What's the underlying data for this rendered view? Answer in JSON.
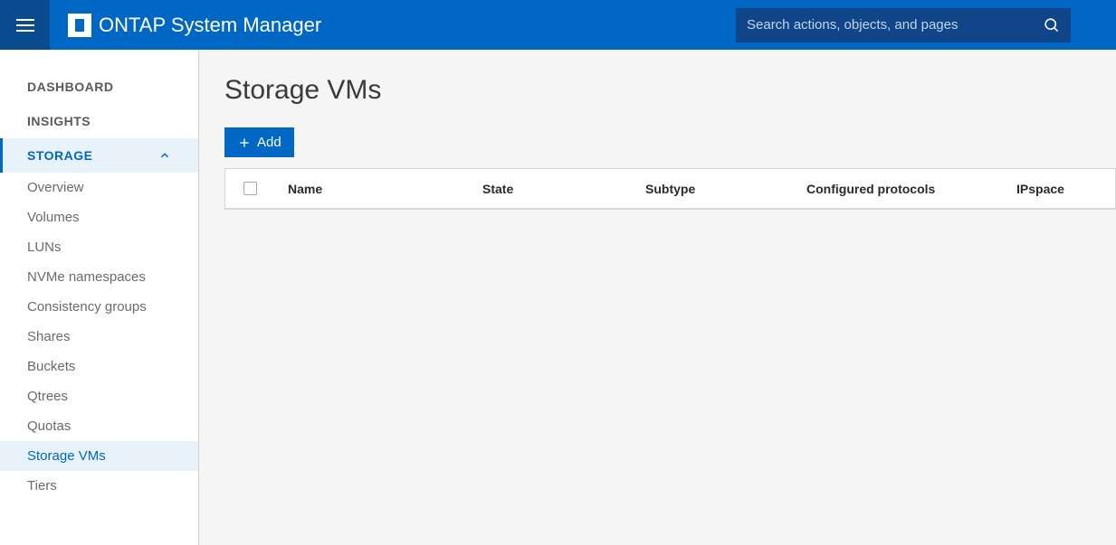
{
  "header": {
    "app_title": "ONTAP System Manager",
    "search_placeholder": "Search actions, objects, and pages"
  },
  "sidebar": {
    "main_items": [
      {
        "label": "DASHBOARD",
        "active": false
      },
      {
        "label": "INSIGHTS",
        "active": false
      },
      {
        "label": "STORAGE",
        "active": true
      }
    ],
    "storage_sub_items": [
      {
        "label": "Overview",
        "active": false
      },
      {
        "label": "Volumes",
        "active": false
      },
      {
        "label": "LUNs",
        "active": false
      },
      {
        "label": "NVMe namespaces",
        "active": false
      },
      {
        "label": "Consistency groups",
        "active": false
      },
      {
        "label": "Shares",
        "active": false
      },
      {
        "label": "Buckets",
        "active": false
      },
      {
        "label": "Qtrees",
        "active": false
      },
      {
        "label": "Quotas",
        "active": false
      },
      {
        "label": "Storage VMs",
        "active": true
      },
      {
        "label": "Tiers",
        "active": false
      }
    ]
  },
  "main": {
    "page_title": "Storage VMs",
    "add_button_label": "Add",
    "table_columns": {
      "name": "Name",
      "state": "State",
      "subtype": "Subtype",
      "protocols": "Configured protocols",
      "ipspace": "IPspace"
    }
  }
}
